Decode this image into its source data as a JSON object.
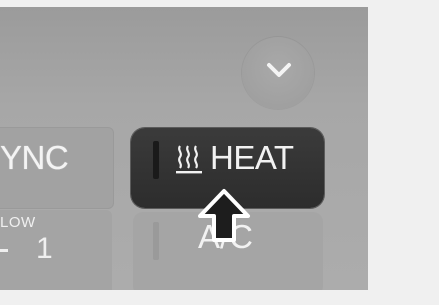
{
  "panel": {
    "sync": {
      "label": "YNC"
    },
    "heat": {
      "label": "HEAT",
      "icon": "seat-heat-icon"
    },
    "flow": {
      "label": "LOW",
      "value": "1"
    },
    "ac": {
      "label": "A/C"
    },
    "chevron": {
      "icon": "chevron-down-icon"
    }
  },
  "overlay": {
    "pointer": "up-arrow-pointer-icon"
  },
  "colors": {
    "panel_bg": "#a5a5a5",
    "heat_button_bg": "#333333",
    "label_text": "#f2f2f2",
    "page_bg": "#f0f0f0"
  }
}
